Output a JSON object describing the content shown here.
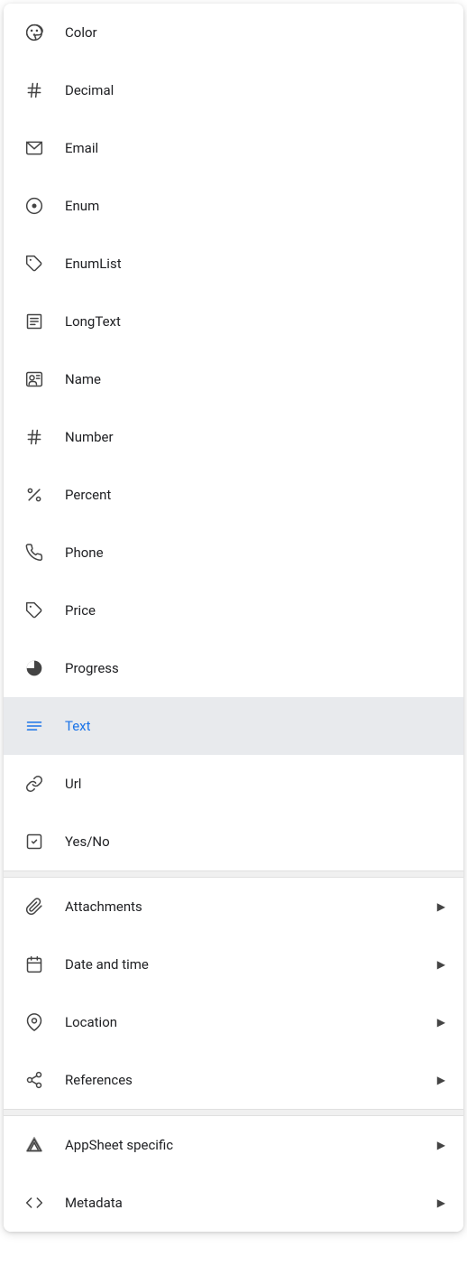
{
  "menu": {
    "items": [
      {
        "id": "color",
        "label": "Color",
        "icon": "palette-icon",
        "hasSubmenu": false,
        "selected": false
      },
      {
        "id": "decimal",
        "label": "Decimal",
        "icon": "hash-icon",
        "hasSubmenu": false,
        "selected": false
      },
      {
        "id": "email",
        "label": "Email",
        "icon": "email-icon",
        "hasSubmenu": false,
        "selected": false
      },
      {
        "id": "enum",
        "label": "Enum",
        "icon": "enum-icon",
        "hasSubmenu": false,
        "selected": false
      },
      {
        "id": "enumlist",
        "label": "EnumList",
        "icon": "tag-icon",
        "hasSubmenu": false,
        "selected": false
      },
      {
        "id": "longtext",
        "label": "LongText",
        "icon": "longtext-icon",
        "hasSubmenu": false,
        "selected": false
      },
      {
        "id": "name",
        "label": "Name",
        "icon": "name-icon",
        "hasSubmenu": false,
        "selected": false
      },
      {
        "id": "number",
        "label": "Number",
        "icon": "hash-icon",
        "hasSubmenu": false,
        "selected": false
      },
      {
        "id": "percent",
        "label": "Percent",
        "icon": "percent-icon",
        "hasSubmenu": false,
        "selected": false
      },
      {
        "id": "phone",
        "label": "Phone",
        "icon": "phone-icon",
        "hasSubmenu": false,
        "selected": false
      },
      {
        "id": "price",
        "label": "Price",
        "icon": "price-icon",
        "hasSubmenu": false,
        "selected": false
      },
      {
        "id": "progress",
        "label": "Progress",
        "icon": "progress-icon",
        "hasSubmenu": false,
        "selected": false
      },
      {
        "id": "text",
        "label": "Text",
        "icon": "text-icon",
        "hasSubmenu": false,
        "selected": true
      },
      {
        "id": "url",
        "label": "Url",
        "icon": "link-icon",
        "hasSubmenu": false,
        "selected": false
      },
      {
        "id": "yes-no",
        "label": "Yes/No",
        "icon": "checkbox-icon",
        "hasSubmenu": false,
        "selected": false
      }
    ],
    "submenuItems": [
      {
        "id": "attachments",
        "label": "Attachments",
        "icon": "attachments-icon",
        "hasSubmenu": true
      },
      {
        "id": "date-and-time",
        "label": "Date and time",
        "icon": "calendar-icon",
        "hasSubmenu": true
      },
      {
        "id": "location",
        "label": "Location",
        "icon": "location-icon",
        "hasSubmenu": true
      },
      {
        "id": "references",
        "label": "References",
        "icon": "references-icon",
        "hasSubmenu": true
      }
    ],
    "bottomItems": [
      {
        "id": "appsheet-specific",
        "label": "AppSheet specific",
        "icon": "appsheet-icon",
        "hasSubmenu": true
      },
      {
        "id": "metadata",
        "label": "Metadata",
        "icon": "metadata-icon",
        "hasSubmenu": true
      }
    ]
  }
}
